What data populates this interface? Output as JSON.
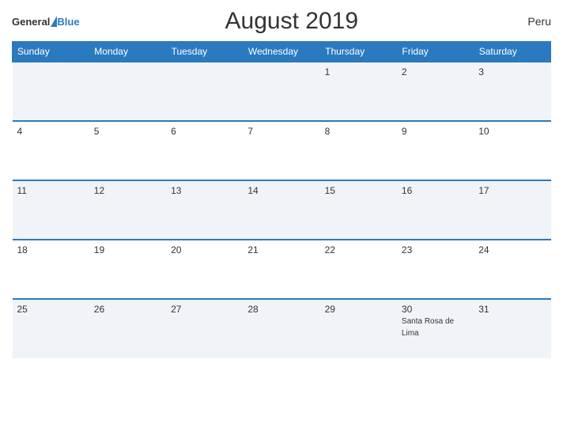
{
  "header": {
    "logo_general": "General",
    "logo_blue": "Blue",
    "title": "August 2019",
    "country": "Peru"
  },
  "weekdays": [
    "Sunday",
    "Monday",
    "Tuesday",
    "Wednesday",
    "Thursday",
    "Friday",
    "Saturday"
  ],
  "weeks": [
    [
      {
        "day": "",
        "event": ""
      },
      {
        "day": "",
        "event": ""
      },
      {
        "day": "",
        "event": ""
      },
      {
        "day": "",
        "event": ""
      },
      {
        "day": "1",
        "event": ""
      },
      {
        "day": "2",
        "event": ""
      },
      {
        "day": "3",
        "event": ""
      }
    ],
    [
      {
        "day": "4",
        "event": ""
      },
      {
        "day": "5",
        "event": ""
      },
      {
        "day": "6",
        "event": ""
      },
      {
        "day": "7",
        "event": ""
      },
      {
        "day": "8",
        "event": ""
      },
      {
        "day": "9",
        "event": ""
      },
      {
        "day": "10",
        "event": ""
      }
    ],
    [
      {
        "day": "11",
        "event": ""
      },
      {
        "day": "12",
        "event": ""
      },
      {
        "day": "13",
        "event": ""
      },
      {
        "day": "14",
        "event": ""
      },
      {
        "day": "15",
        "event": ""
      },
      {
        "day": "16",
        "event": ""
      },
      {
        "day": "17",
        "event": ""
      }
    ],
    [
      {
        "day": "18",
        "event": ""
      },
      {
        "day": "19",
        "event": ""
      },
      {
        "day": "20",
        "event": ""
      },
      {
        "day": "21",
        "event": ""
      },
      {
        "day": "22",
        "event": ""
      },
      {
        "day": "23",
        "event": ""
      },
      {
        "day": "24",
        "event": ""
      }
    ],
    [
      {
        "day": "25",
        "event": ""
      },
      {
        "day": "26",
        "event": ""
      },
      {
        "day": "27",
        "event": ""
      },
      {
        "day": "28",
        "event": ""
      },
      {
        "day": "29",
        "event": ""
      },
      {
        "day": "30",
        "event": "Santa Rosa de Lima"
      },
      {
        "day": "31",
        "event": ""
      }
    ]
  ]
}
